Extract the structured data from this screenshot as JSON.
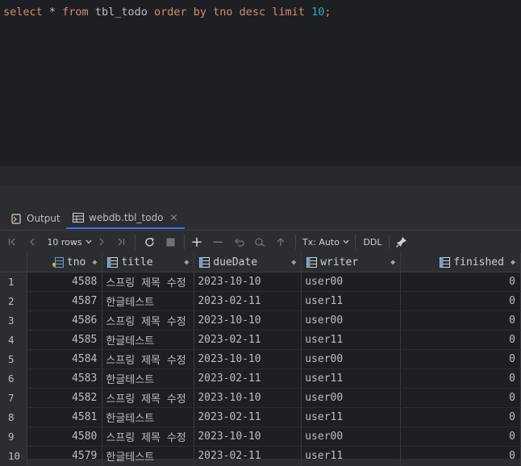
{
  "editor": {
    "kw_select": "select",
    "star": " * ",
    "kw_from": "from",
    "table_name": " tbl_todo ",
    "kw_order": "order by",
    "col_tno": " tno ",
    "kw_desc": "desc",
    "kw_limit": " limit ",
    "limit_value": "10",
    "semicolon": ";"
  },
  "tabs": [
    {
      "label": "Output",
      "icon": "output-icon"
    },
    {
      "label": "webdb.tbl_todo",
      "icon": "table-icon",
      "active": true
    }
  ],
  "toolbar": {
    "rows_label": "10 rows",
    "tx_label": "Tx: Auto",
    "ddl_label": "DDL"
  },
  "columns": [
    {
      "name": "tno",
      "icon": "primary-key-column-icon"
    },
    {
      "name": "title",
      "icon": "column-icon"
    },
    {
      "name": "dueDate",
      "icon": "column-icon"
    },
    {
      "name": "writer",
      "icon": "column-icon"
    },
    {
      "name": "finished",
      "icon": "column-icon"
    }
  ],
  "rows": [
    {
      "n": "1",
      "tno": "4588",
      "title": "스프링 제목 수정",
      "dueDate": "2023-10-10",
      "writer": "user00",
      "finished": "0"
    },
    {
      "n": "2",
      "tno": "4587",
      "title": "한글테스트",
      "dueDate": "2023-02-11",
      "writer": "user11",
      "finished": "0"
    },
    {
      "n": "3",
      "tno": "4586",
      "title": "스프링 제목 수정",
      "dueDate": "2023-10-10",
      "writer": "user00",
      "finished": "0"
    },
    {
      "n": "4",
      "tno": "4585",
      "title": "한글테스트",
      "dueDate": "2023-02-11",
      "writer": "user11",
      "finished": "0"
    },
    {
      "n": "5",
      "tno": "4584",
      "title": "스프링 제목 수정",
      "dueDate": "2023-10-10",
      "writer": "user00",
      "finished": "0"
    },
    {
      "n": "6",
      "tno": "4583",
      "title": "한글테스트",
      "dueDate": "2023-02-11",
      "writer": "user11",
      "finished": "0"
    },
    {
      "n": "7",
      "tno": "4582",
      "title": "스프링 제목 수정",
      "dueDate": "2023-10-10",
      "writer": "user00",
      "finished": "0"
    },
    {
      "n": "8",
      "tno": "4581",
      "title": "한글테스트",
      "dueDate": "2023-02-11",
      "writer": "user11",
      "finished": "0"
    },
    {
      "n": "9",
      "tno": "4580",
      "title": "스프링 제목 수정",
      "dueDate": "2023-10-10",
      "writer": "user00",
      "finished": "0"
    },
    {
      "n": "10",
      "tno": "4579",
      "title": "한글테스트",
      "dueDate": "2023-02-11",
      "writer": "user11",
      "finished": "0"
    }
  ]
}
